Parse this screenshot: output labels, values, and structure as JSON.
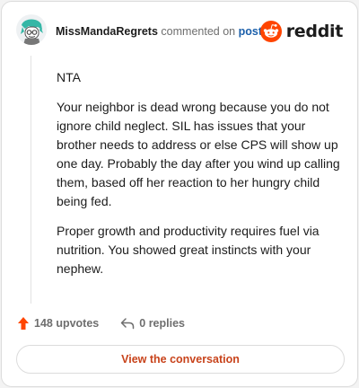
{
  "header": {
    "username": "MissMandaRegrets",
    "action_text": "commented on",
    "post_link": "post",
    "brand": "reddit",
    "brand_color": "#ff4500"
  },
  "comment": {
    "paragraphs": [
      "NTA",
      "Your neighbor is dead wrong because you do not ignore child neglect. SIL has issues that your brother needs to address or else CPS will show up one day. Probably the day after you wind up calling them, based off her reaction to her hungry child being fed.",
      "Proper growth and productivity requires fuel via nutrition. You showed great instincts with your nephew."
    ]
  },
  "actions": {
    "upvotes": "148 upvotes",
    "replies": "0 replies",
    "upvote_color": "#ff4500"
  },
  "cta": {
    "label": "View the conversation",
    "color": "#c8431b"
  },
  "icons": [
    "avatar",
    "reddit-snoo-icon",
    "upvote-arrow-icon",
    "reply-arrow-icon"
  ]
}
